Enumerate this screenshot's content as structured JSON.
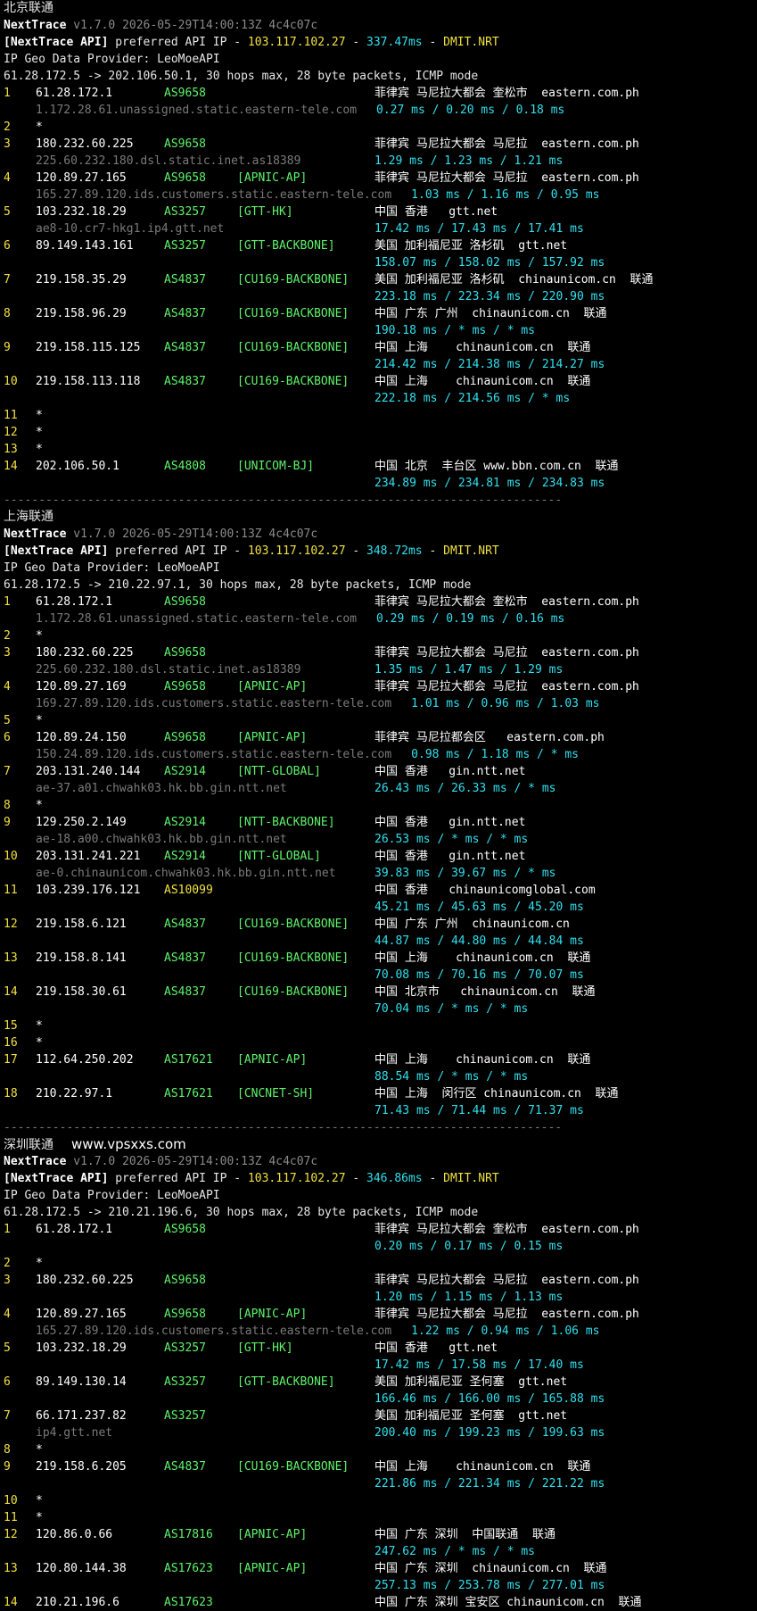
{
  "colors": {
    "background": "#000000",
    "hop_number": "#f0e040",
    "asn": "#5ef26a",
    "asn_highlight": "#f0e040",
    "rtt": "#30e0ee",
    "rdns": "#7a7a7a",
    "text": "#ffffff"
  },
  "sections": [
    {
      "title": "北京联通",
      "site": "",
      "tool": "NextTrace",
      "version": "v1.7.0 2026-05-29T14:00:13Z 4c4c07c",
      "api_label": "[NextTrace API]",
      "api_mid": " preferred API IP - ",
      "api_ip": "103.117.102.27",
      "api_sep": " - ",
      "api_ms": "337.47ms",
      "api_node": "DMIT.NRT",
      "geo_provider": "IP Geo Data Provider: LeoMoeAPI",
      "trace_line": "61.28.172.5 -> 202.106.50.1, 30 hops max, 28 byte packets, ICMP mode",
      "hops": [
        {
          "n": "1",
          "ip": "61.28.172.1",
          "as": "AS9658",
          "tag": "",
          "geo": "菲律宾 马尼拉大都会 奎松市  eastern.com.ph",
          "rdns": "1.172.28.61.unassigned.static.eastern-tele.com",
          "rtt": "0.27 ms / 0.20 ms / 0.18 ms"
        },
        {
          "n": "2",
          "star": "*"
        },
        {
          "n": "3",
          "ip": "180.232.60.225",
          "as": "AS9658",
          "tag": "",
          "geo": "菲律宾 马尼拉大都会 马尼拉  eastern.com.ph",
          "rdns": "225.60.232.180.dsl.static.inet.as18389",
          "rtt": "1.29 ms / 1.23 ms / 1.21 ms"
        },
        {
          "n": "4",
          "ip": "120.89.27.165",
          "as": "AS9658",
          "tag": "[APNIC-AP]",
          "geo": "菲律宾 马尼拉大都会 马尼拉  eastern.com.ph",
          "rdns": "165.27.89.120.ids.customers.static.eastern-tele.com",
          "rtt": "1.03 ms / 1.16 ms / 0.95 ms"
        },
        {
          "n": "5",
          "ip": "103.232.18.29",
          "as": "AS3257",
          "tag": "[GTT-HK]",
          "geo": "中国 香港   gtt.net",
          "rdns": "ae8-10.cr7-hkg1.ip4.gtt.net",
          "rtt": "17.42 ms / 17.43 ms / 17.41 ms"
        },
        {
          "n": "6",
          "ip": "89.149.143.161",
          "as": "AS3257",
          "tag": "[GTT-BACKBONE]",
          "geo": "美国 加利福尼亚 洛杉矶  gtt.net",
          "rdns": "",
          "rtt": "158.07 ms / 158.02 ms / 157.92 ms"
        },
        {
          "n": "7",
          "ip": "219.158.35.29",
          "as": "AS4837",
          "tag": "[CU169-BACKBONE]",
          "geo": "美国 加利福尼亚 洛杉矶  chinaunicom.cn  联通",
          "rdns": "",
          "rtt": "223.18 ms / 223.34 ms / 220.90 ms"
        },
        {
          "n": "8",
          "ip": "219.158.96.29",
          "as": "AS4837",
          "tag": "[CU169-BACKBONE]",
          "geo": "中国 广东 广州  chinaunicom.cn  联通",
          "rdns": "",
          "rtt": "190.18 ms / * ms / * ms"
        },
        {
          "n": "9",
          "ip": "219.158.115.125",
          "as": "AS4837",
          "tag": "[CU169-BACKBONE]",
          "geo": "中国 上海    chinaunicom.cn  联通",
          "rdns": "",
          "rtt": "214.42 ms / 214.38 ms / 214.27 ms"
        },
        {
          "n": "10",
          "ip": "219.158.113.118",
          "as": "AS4837",
          "tag": "[CU169-BACKBONE]",
          "geo": "中国 上海    chinaunicom.cn  联通",
          "rdns": "",
          "rtt": "222.18 ms / 214.56 ms / * ms"
        },
        {
          "n": "11",
          "star": "*"
        },
        {
          "n": "12",
          "star": "*"
        },
        {
          "n": "13",
          "star": "*"
        },
        {
          "n": "14",
          "ip": "202.106.50.1",
          "as": "AS4808",
          "tag": "[UNICOM-BJ]",
          "geo": "中国 北京  丰台区 www.bbn.com.cn  联通",
          "rdns": "",
          "rtt": "234.89 ms / 234.81 ms / 234.83 ms"
        }
      ],
      "separator": "--------------------------------------------------------------------------------"
    },
    {
      "title": "上海联通",
      "site": "",
      "tool": "NextTrace",
      "version": "v1.7.0 2026-05-29T14:00:13Z 4c4c07c",
      "api_label": "[NextTrace API]",
      "api_mid": " preferred API IP - ",
      "api_ip": "103.117.102.27",
      "api_sep": " - ",
      "api_ms": "348.72ms",
      "api_node": "DMIT.NRT",
      "geo_provider": "IP Geo Data Provider: LeoMoeAPI",
      "trace_line": "61.28.172.5 -> 210.22.97.1, 30 hops max, 28 byte packets, ICMP mode",
      "hops": [
        {
          "n": "1",
          "ip": "61.28.172.1",
          "as": "AS9658",
          "tag": "",
          "geo": "菲律宾 马尼拉大都会 奎松市  eastern.com.ph",
          "rdns": "1.172.28.61.unassigned.static.eastern-tele.com",
          "rtt": "0.29 ms / 0.19 ms / 0.16 ms"
        },
        {
          "n": "2",
          "star": "*"
        },
        {
          "n": "3",
          "ip": "180.232.60.225",
          "as": "AS9658",
          "tag": "",
          "geo": "菲律宾 马尼拉大都会 马尼拉  eastern.com.ph",
          "rdns": "225.60.232.180.dsl.static.inet.as18389",
          "rtt": "1.35 ms / 1.47 ms / 1.29 ms"
        },
        {
          "n": "4",
          "ip": "120.89.27.169",
          "as": "AS9658",
          "tag": "[APNIC-AP]",
          "geo": "菲律宾 马尼拉大都会 马尼拉  eastern.com.ph",
          "rdns": "169.27.89.120.ids.customers.static.eastern-tele.com",
          "rtt": "1.01 ms / 0.96 ms / 1.03 ms"
        },
        {
          "n": "5",
          "star": "*"
        },
        {
          "n": "6",
          "ip": "120.89.24.150",
          "as": "AS9658",
          "tag": "[APNIC-AP]",
          "geo": "菲律宾 马尼拉都会区   eastern.com.ph",
          "rdns": "150.24.89.120.ids.customers.static.eastern-tele.com",
          "rtt": "0.98 ms / 1.18 ms / * ms"
        },
        {
          "n": "7",
          "ip": "203.131.240.144",
          "as": "AS2914",
          "tag": "[NTT-GLOBAL]",
          "geo": "中国 香港   gin.ntt.net",
          "rdns": "ae-37.a01.chwahk03.hk.bb.gin.ntt.net",
          "rtt": "26.43 ms / 26.33 ms / * ms"
        },
        {
          "n": "8",
          "star": "*"
        },
        {
          "n": "9",
          "ip": "129.250.2.149",
          "as": "AS2914",
          "tag": "[NTT-BACKBONE]",
          "geo": "中国 香港   gin.ntt.net",
          "rdns": "ae-18.a00.chwahk03.hk.bb.gin.ntt.net",
          "rtt": "26.53 ms / * ms / * ms"
        },
        {
          "n": "10",
          "ip": "203.131.241.221",
          "as": "AS2914",
          "tag": "[NTT-GLOBAL]",
          "geo": "中国 香港   gin.ntt.net",
          "rdns": "ae-0.chinaunicom.chwahk03.hk.bb.gin.ntt.net",
          "rtt": "39.83 ms / 39.67 ms / * ms"
        },
        {
          "n": "11",
          "ip": "103.239.176.121",
          "as": "AS10099",
          "as_hl": true,
          "tag": "",
          "geo": "中国 香港   chinaunicomglobal.com",
          "rdns": "",
          "rtt": "45.21 ms / 45.63 ms / 45.20 ms"
        },
        {
          "n": "12",
          "ip": "219.158.6.121",
          "as": "AS4837",
          "tag": "[CU169-BACKBONE]",
          "geo": "中国 广东 广州  chinaunicom.cn",
          "rdns": "",
          "rtt": "44.87 ms / 44.80 ms / 44.84 ms"
        },
        {
          "n": "13",
          "ip": "219.158.8.141",
          "as": "AS4837",
          "tag": "[CU169-BACKBONE]",
          "geo": "中国 上海    chinaunicom.cn  联通",
          "rdns": "",
          "rtt": "70.08 ms / 70.16 ms / 70.07 ms"
        },
        {
          "n": "14",
          "ip": "219.158.30.61",
          "as": "AS4837",
          "tag": "[CU169-BACKBONE]",
          "geo": "中国 北京市   chinaunicom.cn  联通",
          "rdns": "",
          "rtt": "70.04 ms / * ms / * ms"
        },
        {
          "n": "15",
          "star": "*"
        },
        {
          "n": "16",
          "star": "*"
        },
        {
          "n": "17",
          "ip": "112.64.250.202",
          "as": "AS17621",
          "tag": "[APNIC-AP]",
          "geo": "中国 上海    chinaunicom.cn  联通",
          "rdns": "",
          "rtt": "88.54 ms / * ms / * ms"
        },
        {
          "n": "18",
          "ip": "210.22.97.1",
          "as": "AS17621",
          "tag": "[CNCNET-SH]",
          "geo": "中国 上海  闵行区 chinaunicom.cn  联通",
          "rdns": "",
          "rtt": "71.43 ms / 71.44 ms / 71.37 ms"
        }
      ],
      "separator": "--------------------------------------------------------------------------------"
    },
    {
      "title": "深圳联通",
      "site": "www.vpsxxs.com",
      "tool": "NextTrace",
      "version": "v1.7.0 2026-05-29T14:00:13Z 4c4c07c",
      "api_label": "[NextTrace API]",
      "api_mid": " preferred API IP - ",
      "api_ip": "103.117.102.27",
      "api_sep": " - ",
      "api_ms": "346.86ms",
      "api_node": "DMIT.NRT",
      "geo_provider": "IP Geo Data Provider: LeoMoeAPI",
      "trace_line": "61.28.172.5 -> 210.21.196.6, 30 hops max, 28 byte packets, ICMP mode",
      "hops": [
        {
          "n": "1",
          "ip": "61.28.172.1",
          "as": "AS9658",
          "tag": "",
          "geo": "菲律宾 马尼拉大都会 奎松市  eastern.com.ph",
          "rdns": "",
          "rtt": "0.20 ms / 0.17 ms / 0.15 ms"
        },
        {
          "n": "2",
          "star": "*"
        },
        {
          "n": "3",
          "ip": "180.232.60.225",
          "as": "AS9658",
          "tag": "",
          "geo": "菲律宾 马尼拉大都会 马尼拉  eastern.com.ph",
          "rdns": "",
          "rtt": "1.20 ms / 1.15 ms / 1.13 ms"
        },
        {
          "n": "4",
          "ip": "120.89.27.165",
          "as": "AS9658",
          "tag": "[APNIC-AP]",
          "geo": "菲律宾 马尼拉大都会 马尼拉  eastern.com.ph",
          "rdns": "165.27.89.120.ids.customers.static.eastern-tele.com",
          "rtt": "1.22 ms / 0.94 ms / 1.06 ms"
        },
        {
          "n": "5",
          "ip": "103.232.18.29",
          "as": "AS3257",
          "tag": "[GTT-HK]",
          "geo": "中国 香港   gtt.net",
          "rdns": "",
          "rtt": "17.42 ms / 17.58 ms / 17.40 ms"
        },
        {
          "n": "6",
          "ip": "89.149.130.14",
          "as": "AS3257",
          "tag": "[GTT-BACKBONE]",
          "geo": "美国 加利福尼亚 圣何塞  gtt.net",
          "rdns": "",
          "rtt": "166.46 ms / 166.00 ms / 165.88 ms"
        },
        {
          "n": "7",
          "ip": "66.171.237.82",
          "as": "AS3257",
          "tag": "",
          "geo": "美国 加利福尼亚 圣何塞  gtt.net",
          "rdns": "ip4.gtt.net",
          "rtt": "200.40 ms / 199.23 ms / 199.63 ms"
        },
        {
          "n": "8",
          "star": "*"
        },
        {
          "n": "9",
          "ip": "219.158.6.205",
          "as": "AS4837",
          "tag": "[CU169-BACKBONE]",
          "geo": "中国 上海    chinaunicom.cn  联通",
          "rdns": "",
          "rtt": "221.86 ms / 221.34 ms / 221.22 ms"
        },
        {
          "n": "10",
          "star": "*"
        },
        {
          "n": "11",
          "star": "*"
        },
        {
          "n": "12",
          "ip": "120.86.0.66",
          "as": "AS17816",
          "tag": "[APNIC-AP]",
          "geo": "中国 广东 深圳  中国联通  联通",
          "rdns": "",
          "rtt": "247.62 ms / * ms / * ms"
        },
        {
          "n": "13",
          "ip": "120.80.144.38",
          "as": "AS17623",
          "tag": "[APNIC-AP]",
          "geo": "中国 广东 深圳  chinaunicom.cn  联通",
          "rdns": "",
          "rtt": "257.13 ms / 253.78 ms / 277.01 ms"
        },
        {
          "n": "14",
          "ip": "210.21.196.6",
          "as": "AS17623",
          "tag": "",
          "geo": "中国 广东 深圳 宝安区 chinaunicom.cn  联通",
          "rdns": "",
          "rtt": ""
        }
      ],
      "separator": ""
    }
  ]
}
